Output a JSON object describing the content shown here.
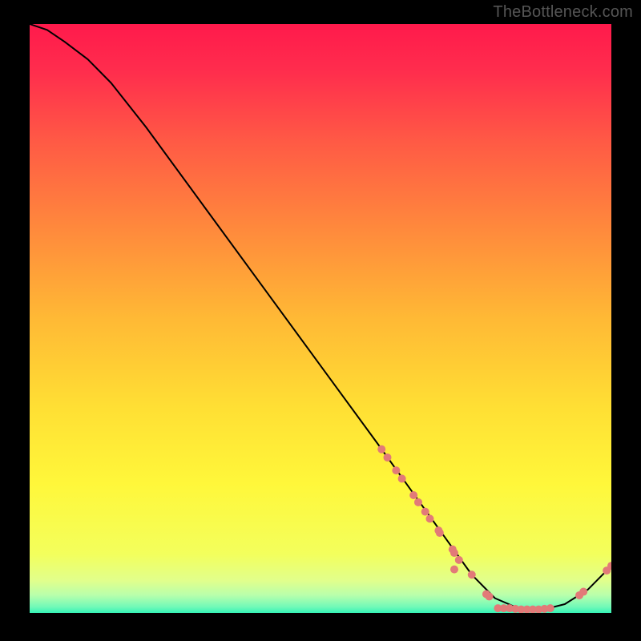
{
  "watermark": "TheBottleneck.com",
  "chart_data": {
    "type": "line",
    "title": "",
    "xlabel": "",
    "ylabel": "",
    "xlim": [
      0,
      100
    ],
    "ylim": [
      0,
      100
    ],
    "grid": false,
    "legend": false,
    "axes_visible": false,
    "background_gradient": {
      "description": "vertical gradient representing bottleneck severity, red (top) -> yellow (mid) -> green (bottom)",
      "stops": [
        {
          "pos": 0.0,
          "hex": "#ff1a4c"
        },
        {
          "pos": 0.08,
          "hex": "#ff2d4d"
        },
        {
          "pos": 0.2,
          "hex": "#ff5a45"
        },
        {
          "pos": 0.35,
          "hex": "#ff8a3c"
        },
        {
          "pos": 0.5,
          "hex": "#ffb935"
        },
        {
          "pos": 0.65,
          "hex": "#ffdf34"
        },
        {
          "pos": 0.78,
          "hex": "#fff73a"
        },
        {
          "pos": 0.9,
          "hex": "#f3ff5c"
        },
        {
          "pos": 0.945,
          "hex": "#e1ff8c"
        },
        {
          "pos": 0.97,
          "hex": "#b8ffac"
        },
        {
          "pos": 0.99,
          "hex": "#70f9b8"
        },
        {
          "pos": 1.0,
          "hex": "#34f3b5"
        }
      ]
    },
    "series": [
      {
        "name": "bottleneck-curve",
        "color": "#000000",
        "x": [
          0,
          3,
          6,
          10,
          14,
          20,
          30,
          40,
          50,
          60,
          68,
          72,
          76,
          80,
          84,
          88,
          92,
          96,
          100
        ],
        "y": [
          100,
          99,
          97,
          94,
          90,
          82.5,
          69,
          55.5,
          42,
          28.5,
          17.5,
          12,
          6.5,
          2.5,
          0.8,
          0.5,
          1.5,
          4,
          8
        ]
      },
      {
        "name": "scatter-points",
        "type": "scatter",
        "color": "#e27a78",
        "radius": 5,
        "points": [
          {
            "x": 60.5,
            "y": 27.8
          },
          {
            "x": 61.5,
            "y": 26.4
          },
          {
            "x": 63.0,
            "y": 24.2
          },
          {
            "x": 64.0,
            "y": 22.8
          },
          {
            "x": 66.0,
            "y": 20.0
          },
          {
            "x": 66.8,
            "y": 18.8
          },
          {
            "x": 68.0,
            "y": 17.2
          },
          {
            "x": 68.8,
            "y": 16.0
          },
          {
            "x": 70.3,
            "y": 14.0
          },
          {
            "x": 70.5,
            "y": 13.6
          },
          {
            "x": 72.7,
            "y": 10.8
          },
          {
            "x": 73.0,
            "y": 10.2
          },
          {
            "x": 73.0,
            "y": 7.4
          },
          {
            "x": 73.8,
            "y": 9.0
          },
          {
            "x": 76.0,
            "y": 6.5
          },
          {
            "x": 78.5,
            "y": 3.2
          },
          {
            "x": 79.0,
            "y": 2.8
          },
          {
            "x": 80.5,
            "y": 0.8
          },
          {
            "x": 81.5,
            "y": 0.8
          },
          {
            "x": 82.5,
            "y": 0.8
          },
          {
            "x": 83.5,
            "y": 0.7
          },
          {
            "x": 84.5,
            "y": 0.6
          },
          {
            "x": 85.5,
            "y": 0.6
          },
          {
            "x": 86.5,
            "y": 0.6
          },
          {
            "x": 87.5,
            "y": 0.6
          },
          {
            "x": 88.5,
            "y": 0.7
          },
          {
            "x": 89.5,
            "y": 0.8
          },
          {
            "x": 94.5,
            "y": 3.0
          },
          {
            "x": 95.2,
            "y": 3.6
          },
          {
            "x": 99.2,
            "y": 7.2
          },
          {
            "x": 100.0,
            "y": 8.0
          }
        ]
      }
    ]
  }
}
